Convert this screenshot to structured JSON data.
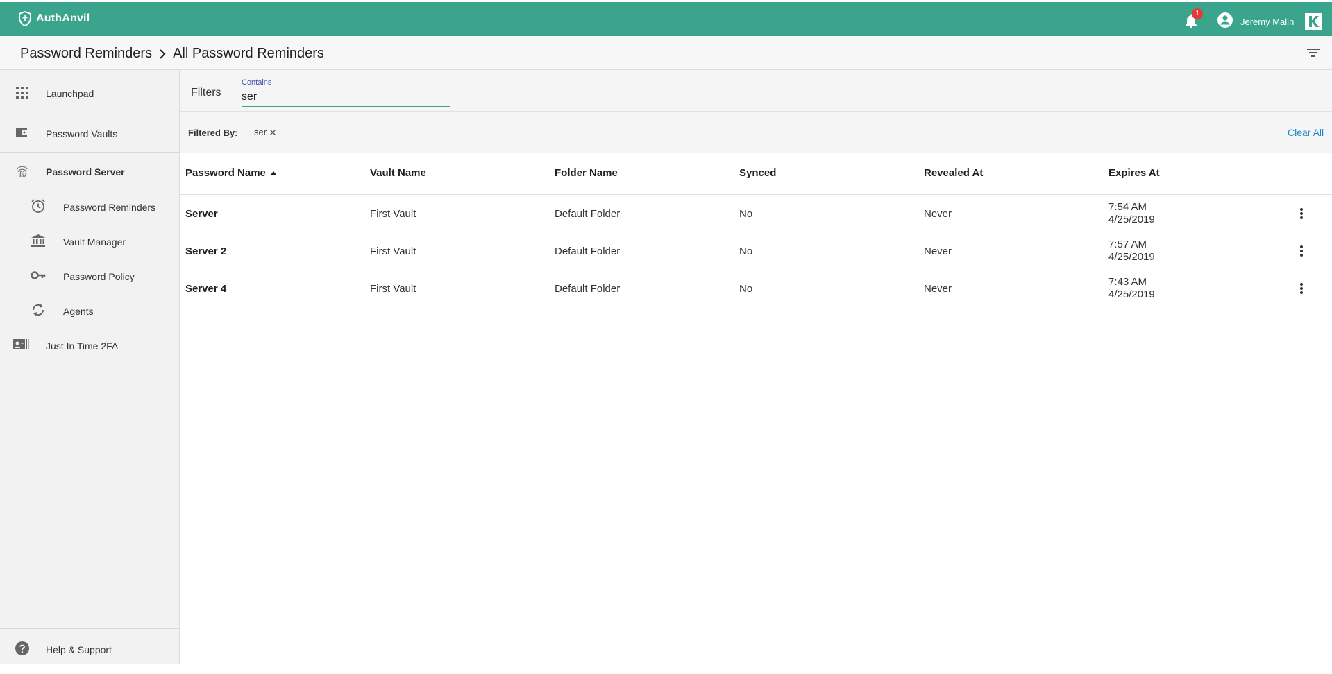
{
  "app": {
    "brand": "AuthAnvil"
  },
  "header": {
    "notification_count": "1",
    "user_name": "Jeremy Malin"
  },
  "breadcrumb": {
    "parent": "Password Reminders",
    "current": "All Password Reminders"
  },
  "sidebar": {
    "items": [
      {
        "label": "Launchpad",
        "icon": "apps-grid-icon"
      },
      {
        "label": "Password Vaults",
        "icon": "wallet-icon"
      },
      {
        "label": "Password Server",
        "icon": "fingerprint-icon"
      },
      {
        "label": "Password Reminders",
        "icon": "alarm-clock-icon"
      },
      {
        "label": "Vault Manager",
        "icon": "bank-icon"
      },
      {
        "label": "Password Policy",
        "icon": "key-icon"
      },
      {
        "label": "Agents",
        "icon": "sync-icon"
      },
      {
        "label": "Just In Time 2FA",
        "icon": "id-card-icon"
      }
    ],
    "help": "Help & Support"
  },
  "filters": {
    "label": "Filters",
    "contains_label": "Contains",
    "contains_value": "ser",
    "filtered_by_label": "Filtered By:",
    "chip": "ser",
    "clear_all": "Clear All"
  },
  "table": {
    "columns": [
      "Password Name",
      "Vault Name",
      "Folder Name",
      "Synced",
      "Revealed At",
      "Expires At"
    ],
    "rows": [
      {
        "name": "Server",
        "vault": "First Vault",
        "folder": "Default Folder",
        "synced": "No",
        "revealed": "Never",
        "expires_time": "7:54 AM",
        "expires_date": "4/25/2019"
      },
      {
        "name": "Server 2",
        "vault": "First Vault",
        "folder": "Default Folder",
        "synced": "No",
        "revealed": "Never",
        "expires_time": "7:57 AM",
        "expires_date": "4/25/2019"
      },
      {
        "name": "Server 4",
        "vault": "First Vault",
        "folder": "Default Folder",
        "synced": "No",
        "revealed": "Never",
        "expires_time": "7:43 AM",
        "expires_date": "4/25/2019"
      }
    ]
  },
  "colors": {
    "brand_green": "#3aa58c",
    "link_blue": "#1e88c8",
    "badge_red": "#e53935"
  }
}
